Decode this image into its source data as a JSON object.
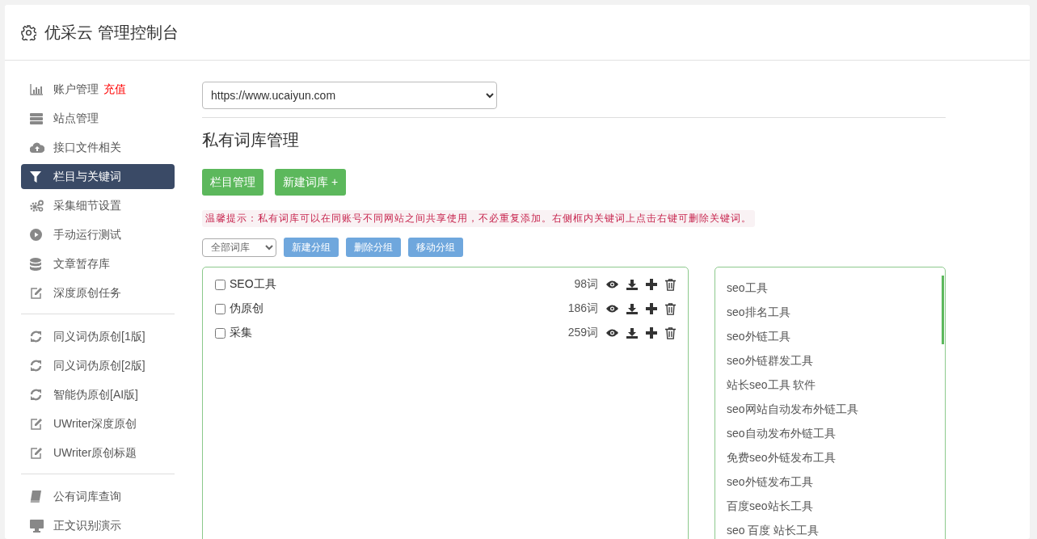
{
  "header": {
    "title": "优采云 管理控制台"
  },
  "sidebar": {
    "sections": [
      {
        "items": [
          {
            "label": "账户管理",
            "badge": "充值",
            "selected": false
          },
          {
            "label": "站点管理",
            "selected": false
          },
          {
            "label": "接口文件相关",
            "selected": false
          },
          {
            "label": "栏目与关键词",
            "selected": true
          },
          {
            "label": "采集细节设置",
            "selected": false
          },
          {
            "label": "手动运行测试",
            "selected": false
          },
          {
            "label": "文章暂存库",
            "selected": false
          },
          {
            "label": "深度原创任务",
            "selected": false
          }
        ]
      },
      {
        "items": [
          {
            "label": "同义词伪原创[1版]",
            "selected": false
          },
          {
            "label": "同义词伪原创[2版]",
            "selected": false
          },
          {
            "label": "智能伪原创[AI版]",
            "selected": false
          },
          {
            "label": "UWriter深度原创",
            "selected": false
          },
          {
            "label": "UWriter原创标题",
            "selected": false
          }
        ]
      },
      {
        "items": [
          {
            "label": "公有词库查询",
            "selected": false
          },
          {
            "label": "正文识别演示",
            "selected": false
          }
        ]
      }
    ]
  },
  "site_select": {
    "value": "https://www.ucaiyun.com"
  },
  "section_title": "私有词库管理",
  "action_buttons": [
    "栏目管理",
    "新建词库 +"
  ],
  "tip": "温馨提示：私有词库可以在同账号不同网站之间共享使用，不必重复添加。右侧框内关键词上点击右键可删除关键词。",
  "group_toolbar": {
    "filter_value": "全部词库",
    "buttons": [
      "新建分组",
      "删除分组",
      "移动分组"
    ]
  },
  "libraries": [
    {
      "name": "SEO工具",
      "count": "98词",
      "checked": false
    },
    {
      "name": "伪原创",
      "count": "186词",
      "checked": false
    },
    {
      "name": "采集",
      "count": "259词",
      "checked": false
    }
  ],
  "keywords": [
    "seo工具",
    "seo排名工具",
    "seo外链工具",
    "seo外链群发工具",
    "站长seo工具 软件",
    "seo网站自动发布外链工具",
    "seo自动发布外链工具",
    "免费seo外链发布工具",
    "seo外链发布工具",
    "百度seo站长工具",
    "seo 百度 站长工具"
  ]
}
